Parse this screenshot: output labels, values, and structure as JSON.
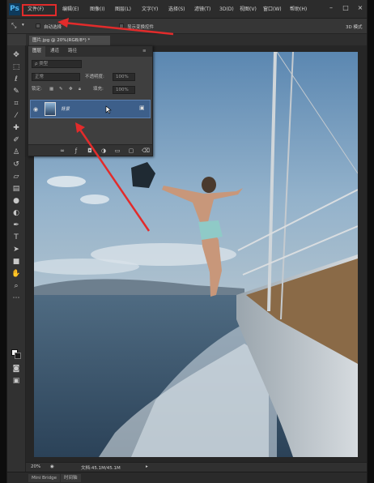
{
  "app": {
    "logo": "Ps"
  },
  "menu": {
    "items": [
      "文件(F)",
      "编辑(E)",
      "图像(I)",
      "图层(L)",
      "文字(Y)",
      "选择(S)",
      "滤镜(T)",
      "3D(D)",
      "视图(V)",
      "窗口(W)",
      "帮助(H)"
    ],
    "highlighted": "文件(F)"
  },
  "options": {
    "auto_select_label": "自动选择",
    "transform_controls_label": "显示变换控件",
    "mode_3d": "3D 模式"
  },
  "document": {
    "tab_title": "图片.jpg @ 20%(RGB/8*) *"
  },
  "layers_panel": {
    "tabs": [
      "图层",
      "通道",
      "路径"
    ],
    "kind_label": "ρ 类型",
    "blend_mode": "正常",
    "opacity_label": "不透明度:",
    "opacity_value": "100%",
    "lock_label": "锁定:",
    "fill_label": "填充:",
    "fill_value": "100%",
    "layer_name": "背景"
  },
  "status": {
    "zoom": "20%",
    "doc_info": "文档:45.1M/45.1M"
  },
  "mini_bridge": {
    "tabs": [
      "Mini Bridge",
      "时间轴"
    ]
  },
  "colors": {
    "annotation_red": "#e22b2b",
    "layer_selected": "#3d5f8a"
  }
}
